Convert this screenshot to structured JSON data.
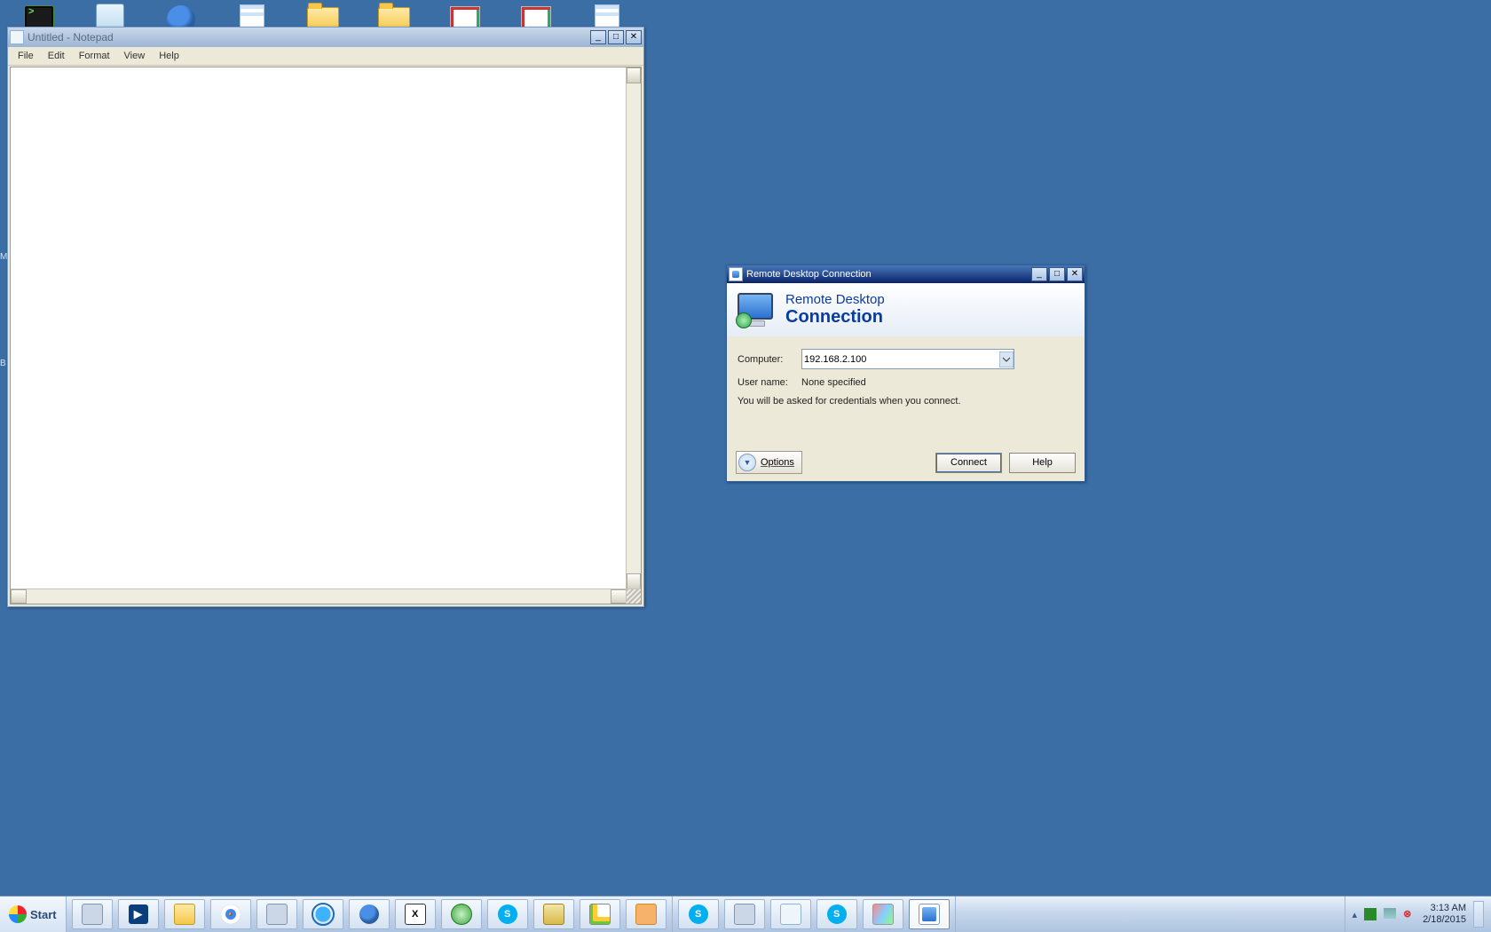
{
  "notepad": {
    "title": "Untitled - Notepad",
    "menus": {
      "file": "File",
      "edit": "Edit",
      "format": "Format",
      "view": "View",
      "help": "Help"
    }
  },
  "rdc": {
    "title": "Remote Desktop Connection",
    "banner_line1": "Remote Desktop",
    "banner_line2": "Connection",
    "computer_label": "Computer:",
    "computer_value": "192.168.2.100",
    "username_label": "User name:",
    "username_value": "None specified",
    "hint": "You will be asked for credentials when you connect.",
    "options_label": "Options",
    "connect_label": "Connect",
    "help_label": "Help"
  },
  "taskbar": {
    "start": "Start",
    "time": "3:13 AM",
    "date": "2/18/2015"
  }
}
